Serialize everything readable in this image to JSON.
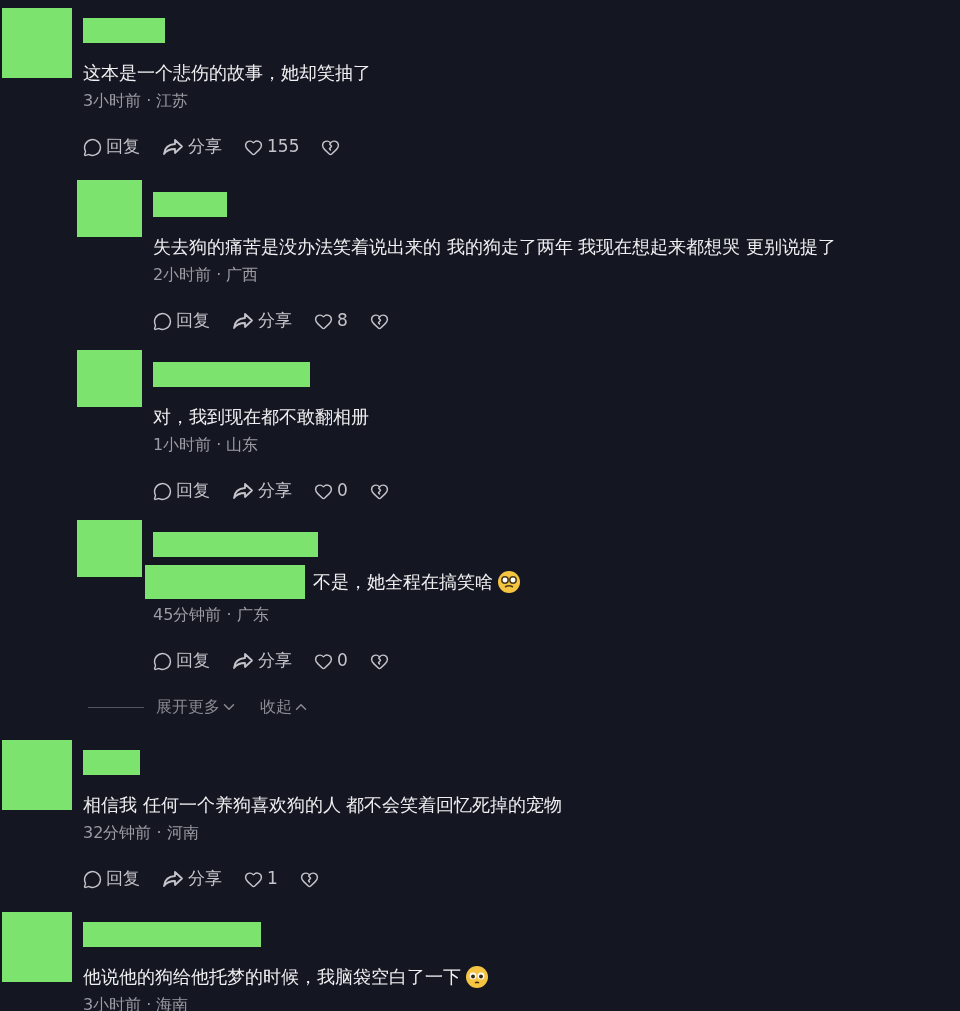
{
  "comments": [
    {
      "text": "这本是一个悲伤的故事，她却笑抽了",
      "meta": "3小时前 · 江苏",
      "extra_redaction": false,
      "actions": {
        "reply": "回复",
        "share": "分享",
        "likes": "155"
      },
      "replies": [
        {
          "text": "失去狗的痛苦是没办法笑着说出来的 我的狗走了两年 我现在想起来都想哭 更别说提了",
          "meta": "2小时前 · 广西",
          "extra_redaction": false,
          "actions": {
            "reply": "回复",
            "share": "分享",
            "likes": "8"
          }
        },
        {
          "text": "对，我到现在都不敢翻相册",
          "meta": "1小时前 · 山东",
          "extra_redaction": false,
          "actions": {
            "reply": "回复",
            "share": "分享",
            "likes": "0"
          }
        },
        {
          "text": "不是，她全程在搞笑啥",
          "emoji": {
            "kind": "glasses"
          },
          "meta": "45分钟前 · 广东",
          "extra_redaction": true,
          "actions": {
            "reply": "回复",
            "share": "分享",
            "likes": "0"
          }
        }
      ],
      "reply_controls": {
        "expand": "展开更多",
        "collapse": "收起"
      }
    },
    {
      "text": "相信我 任何一个养狗喜欢狗的人 都不会笑着回忆死掉的宠物",
      "meta": "32分钟前 · 河南",
      "extra_redaction": false,
      "actions": {
        "reply": "回复",
        "share": "分享",
        "likes": "1"
      }
    },
    {
      "text": "他说他的狗给他托梦的时候，我脑袋空白了一下",
      "emoji": {
        "kind": "pleading"
      },
      "meta": "3小时前 · 海南",
      "extra_redaction": false
    }
  ]
}
